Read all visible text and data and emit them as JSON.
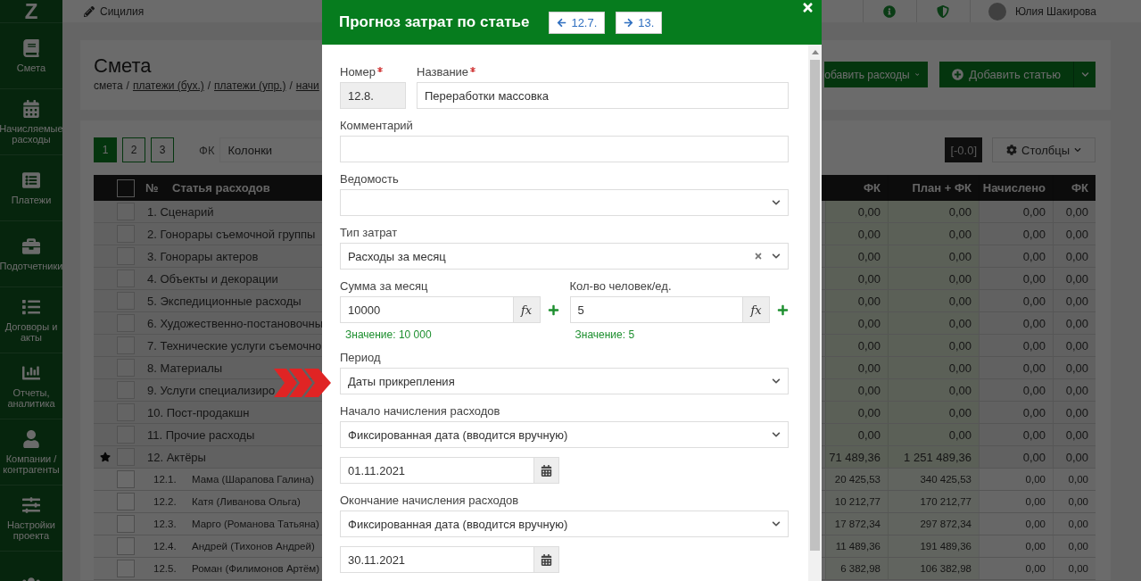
{
  "logo": "Z",
  "sidebar": {
    "items": [
      {
        "label": "Смета"
      },
      {
        "label": "Начисляемые расходы"
      },
      {
        "label": "Платежи"
      },
      {
        "label": "Подотчетники"
      },
      {
        "label": "Договоры и акты"
      },
      {
        "label": "Отчеты, аналитика"
      },
      {
        "label": "Компании / контрагенты"
      },
      {
        "label": "Настройки проекта"
      }
    ]
  },
  "header": {
    "project": "Сицилия",
    "user": "Юлия Шакирова"
  },
  "page": {
    "title": "Смета",
    "breadcrumb": [
      {
        "label": "смета",
        "link": false
      },
      {
        "label": "/",
        "link": false
      },
      {
        "label": "платежи (бух.)",
        "link": true
      },
      {
        "label": "/",
        "link": false
      },
      {
        "label": "платежи (упр.)",
        "link": true
      },
      {
        "label": "/",
        "link": false
      },
      {
        "label": "начи",
        "link": true
      }
    ],
    "actions": [
      {
        "label": "обавить расходы",
        "kind": "dropdown"
      },
      {
        "label": "Добавить статью",
        "kind": "split"
      }
    ]
  },
  "toolbar": {
    "pages": [
      {
        "label": "1",
        "selected": true
      },
      {
        "label": "2",
        "selected": false
      },
      {
        "label": "3",
        "selected": false
      }
    ],
    "filter_label": "ФК",
    "columns_select": "Колонки",
    "rounding": "[-0.0]",
    "columns_button": "Столбцы"
  },
  "table": {
    "select_all_checked": false,
    "columns": [
      "№",
      "Статья расходов",
      "ФК",
      "План + ФК",
      "Начислено",
      "ФК"
    ],
    "rows": [
      {
        "kind": "group",
        "starred": false,
        "checked": false,
        "name": "1. Сценарий",
        "values": [
          "0,00",
          "0,00",
          "0,00",
          "0,00"
        ]
      },
      {
        "kind": "group",
        "starred": false,
        "checked": false,
        "name": "2. Гонорары съемочной группы",
        "values": [
          "0,00",
          "0,00",
          "0,00",
          "0,00"
        ]
      },
      {
        "kind": "group",
        "starred": false,
        "checked": false,
        "name": "3. Гонорары актеров",
        "values": [
          "0,00",
          "0,00",
          "0,00",
          "0,00"
        ]
      },
      {
        "kind": "group",
        "starred": false,
        "checked": false,
        "name": "4. Объекты и декорации",
        "values": [
          "0,00",
          "0,00",
          "0,00",
          "0,00"
        ]
      },
      {
        "kind": "group",
        "starred": false,
        "checked": false,
        "name": "5. Экспедиционные расходы",
        "values": [
          "0,00",
          "0,00",
          "0,00",
          "0,00"
        ]
      },
      {
        "kind": "group",
        "starred": false,
        "checked": false,
        "name": "6. Художественно-постановочны",
        "values": [
          "0,00",
          "0,00",
          "0,00",
          "0,00"
        ]
      },
      {
        "kind": "group",
        "starred": false,
        "checked": false,
        "name": "7. Технические услуги съемочно",
        "values": [
          "0,00",
          "0,00",
          "0,00",
          "0,00"
        ]
      },
      {
        "kind": "group",
        "starred": false,
        "checked": false,
        "name": "8. Материалы",
        "values": [
          "0,00",
          "0,00",
          "0,00",
          "0,00"
        ]
      },
      {
        "kind": "group",
        "starred": false,
        "checked": false,
        "name": "9. Услуги специализиро",
        "values": [
          "0,00",
          "0,00",
          "0,00",
          "0,00"
        ]
      },
      {
        "kind": "group",
        "starred": false,
        "checked": false,
        "name": "10. Пост-продакшн",
        "values": [
          "0,00",
          "0,00",
          "0,00",
          "0,00"
        ]
      },
      {
        "kind": "group",
        "starred": false,
        "checked": false,
        "name": "11. Прочие расходы",
        "values": [
          "0,00",
          "0,00",
          "0,00",
          "0,00"
        ]
      },
      {
        "kind": "group",
        "starred": true,
        "checked": false,
        "name": "12. Актёры",
        "values": [
          "71 489,36",
          "1 251 489,36",
          "0,00",
          "0,00"
        ]
      },
      {
        "kind": "item",
        "starred": false,
        "checked": false,
        "number": "12.1.",
        "name": "Мама (Шарапова Галина)",
        "values": [
          "20 425,53",
          "340 425,53",
          "0,00",
          "0,00"
        ]
      },
      {
        "kind": "item",
        "starred": false,
        "checked": false,
        "number": "12.2.",
        "name": "Катя (Ливанова Ольга)",
        "values": [
          "10 212,77",
          "170 212,77",
          "0,00",
          "0,00"
        ]
      },
      {
        "kind": "item",
        "starred": false,
        "checked": false,
        "number": "12.3.",
        "name": "Марго (Романова Татьяна)",
        "values": [
          "17 872,34",
          "297 872,34",
          "0,00",
          "0,00"
        ]
      },
      {
        "kind": "item",
        "starred": false,
        "checked": false,
        "number": "12.4.",
        "name": "Андрей (Тихонов Андрей)",
        "values": [
          "11 489,36",
          "191 489,36",
          "0,00",
          "0,00"
        ]
      },
      {
        "kind": "item",
        "starred": false,
        "checked": false,
        "number": "12.5.",
        "name": "Роман (Филимонов Артём)",
        "values": [
          "6 382,98",
          "106 382,98",
          "0,00",
          "0,00"
        ]
      }
    ]
  },
  "modal": {
    "title": "Прогноз затрат по статье",
    "prev": "12.7.",
    "next": "13.",
    "rows": [
      {
        "fields": [
          {
            "kind": "text",
            "label": "Номер",
            "required": true,
            "disabled": true,
            "value": "12.8."
          },
          {
            "kind": "text",
            "label": "Название",
            "required": true,
            "disabled": false,
            "value": "Переработки массовка"
          }
        ]
      },
      {
        "fields": [
          {
            "kind": "text",
            "label": "Комментарий",
            "required": false,
            "disabled": false
          }
        ]
      },
      {
        "fields": [
          {
            "kind": "select",
            "label": "Ведомость",
            "clearable": false
          }
        ]
      },
      {
        "fields": [
          {
            "kind": "select",
            "label": "Тип затрат",
            "clearable": true,
            "value": "Расходы за месяц"
          }
        ]
      },
      {
        "fields": [
          {
            "kind": "formula",
            "label": "Сумма за месяц",
            "value": "10000",
            "button": "fx",
            "hint": "Значение: 10 000"
          },
          {
            "kind": "formula",
            "label": "Кол-во человек/ед.",
            "value": "5",
            "button": "fx",
            "hint": "Значение: 5"
          }
        ]
      },
      {
        "fields": [
          {
            "kind": "select",
            "label": "Период",
            "clearable": false,
            "value": "Даты прикрепления"
          }
        ]
      },
      {
        "fields": [
          {
            "kind": "select",
            "label": "Начало начисления расходов",
            "clearable": false,
            "value": "Фиксированная дата (вводится вручную)"
          }
        ]
      },
      {
        "fields": [
          {
            "kind": "date",
            "value": "01.11.2021"
          }
        ]
      },
      {
        "fields": [
          {
            "kind": "select",
            "label": "Окончание начисления расходов",
            "clearable": false,
            "value": "Фиксированная дата (вводится вручную)"
          }
        ]
      },
      {
        "fields": [
          {
            "kind": "date",
            "value": "30.11.2021"
          }
        ]
      }
    ]
  }
}
